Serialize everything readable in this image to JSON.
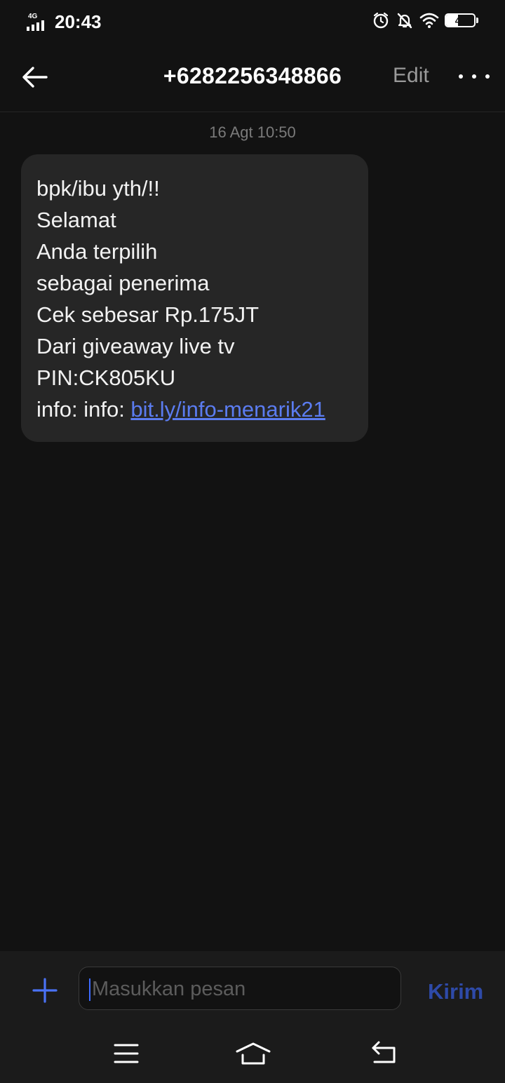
{
  "status_bar": {
    "network": "4G",
    "time": "20:43",
    "battery_level": "43",
    "battery_fraction": 0.43,
    "icons": [
      "alarm-icon",
      "bell-muted-icon",
      "wifi-icon",
      "battery-icon"
    ]
  },
  "header": {
    "title": "+6282256348866",
    "edit_label": "Edit",
    "back_icon": "arrow-left-icon",
    "more_icon": "more-dots-icon"
  },
  "thread": {
    "timestamp": "16 Agt 10:50",
    "message": {
      "lines": [
        "bpk/ibu yth/!!",
        "Selamat",
        "Anda terpilih",
        "sebagai penerima",
        "Cek sebesar Rp.175JT",
        "Dari giveaway live tv",
        "PIN:CK805KU"
      ],
      "info_prefix": "info: info: ",
      "link_text": "bit.ly/info-menarik21"
    }
  },
  "composer": {
    "placeholder": "Masukkan pesan",
    "value": "",
    "send_label": "Kirim",
    "attach_icon": "plus-icon"
  },
  "nav_bar": {
    "icons": [
      "menu-icon",
      "home-icon",
      "back-icon"
    ]
  },
  "colors": {
    "background": "#121212",
    "bubble": "#262626",
    "link": "#5b7cf0",
    "accent": "#3d6bff",
    "send_disabled": "#2e4aa8"
  }
}
